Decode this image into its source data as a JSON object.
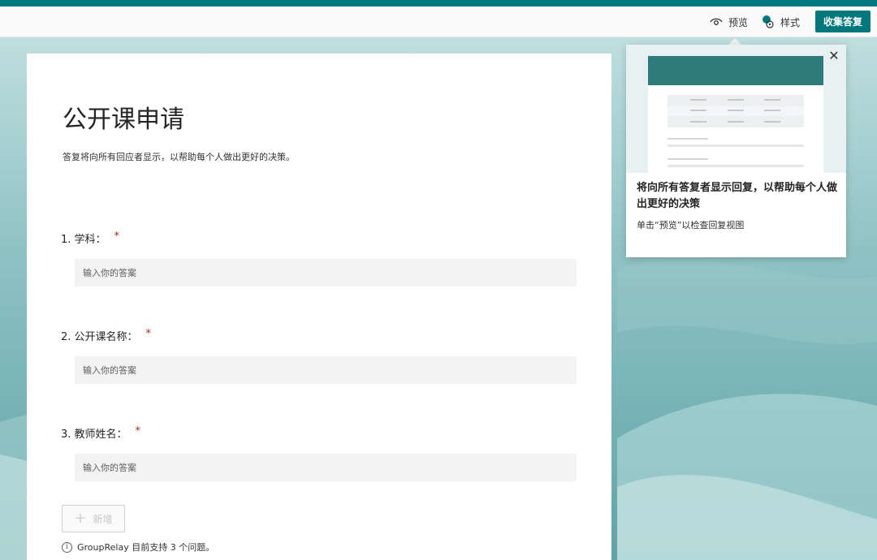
{
  "topbar": {
    "preview_label": "预览",
    "style_label": "样式",
    "collect_label": "收集答复"
  },
  "form": {
    "title": "公开课申请",
    "description": "答复将向所有回应者显示，以帮助每个人做出更好的决策。",
    "questions": [
      {
        "label": "1. 学科：",
        "required": "*",
        "placeholder": "输入你的答案"
      },
      {
        "label": "2. 公开课名称：",
        "required": "*",
        "placeholder": "输入你的答案"
      },
      {
        "label": "3. 教师姓名：",
        "required": "*",
        "placeholder": "输入你的答案"
      }
    ],
    "add_label": "新增",
    "info_text": "GroupRelay 目前支持 3 个问题。"
  },
  "tooltip": {
    "title": "将向所有答复者显示回复，以帮助每个人做出更好的决策",
    "subtitle": "单击“预览”以检查回复视图"
  },
  "colors": {
    "accent": "#03787c",
    "required": "#a4262c"
  },
  "icons": [
    "eye-icon",
    "palette-icon",
    "close-icon",
    "plus-icon",
    "info-icon"
  ]
}
